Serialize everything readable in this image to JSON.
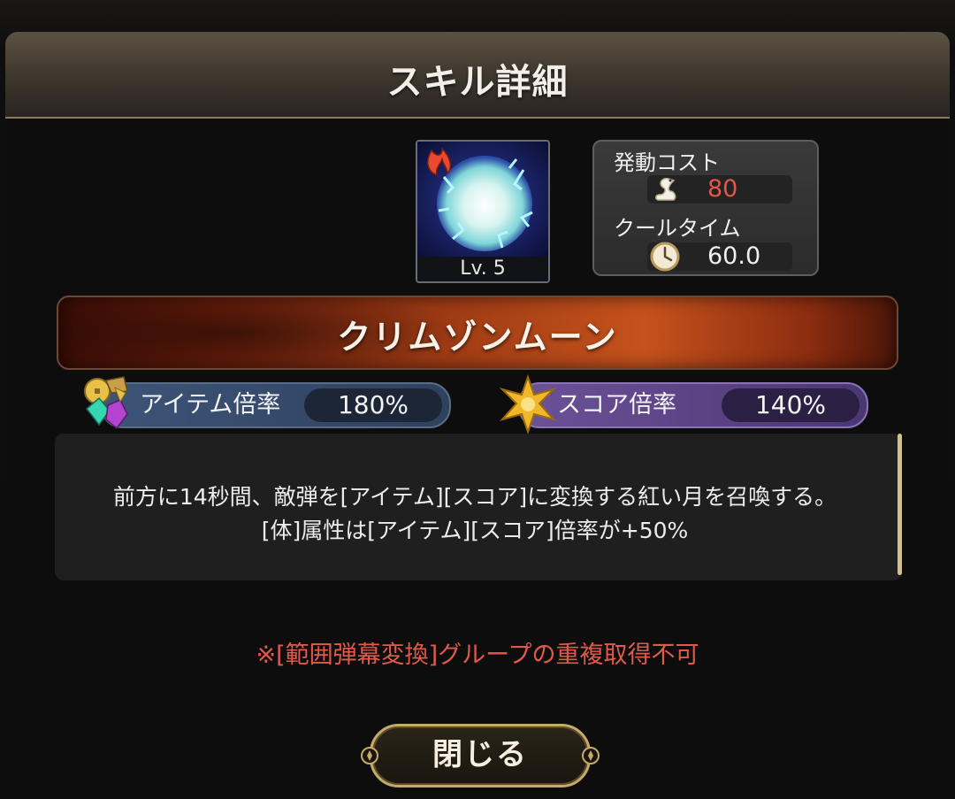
{
  "dialog": {
    "title": "スキル詳細",
    "skill": {
      "level": "Lv. 5",
      "name": "クリムゾンムーン",
      "icon": "crimson-moon-skill-icon"
    },
    "stats": {
      "cost_label": "発動コスト",
      "cost_value": "80",
      "cost_color": "#e2574a",
      "cost_icon": "swan-icon",
      "cooltime_label": "クールタイム",
      "cooltime_value": "60.0",
      "cooltime_icon": "clock-icon"
    },
    "multipliers": {
      "item_label": "アイテム倍率",
      "item_value": "180%",
      "item_icon": "gem-coin-icon",
      "score_label": "スコア倍率",
      "score_value": "140%",
      "score_icon": "star-icon"
    },
    "description": [
      "前方に14秒間、敵弾を[アイテム][スコア]に変換する紅い月を召喚する。",
      "[体]属性は[アイテム][スコア]倍率が+50%"
    ],
    "warning": "※[範囲弾幕変換]グループの重複取得不可",
    "close_label": "閉じる"
  }
}
